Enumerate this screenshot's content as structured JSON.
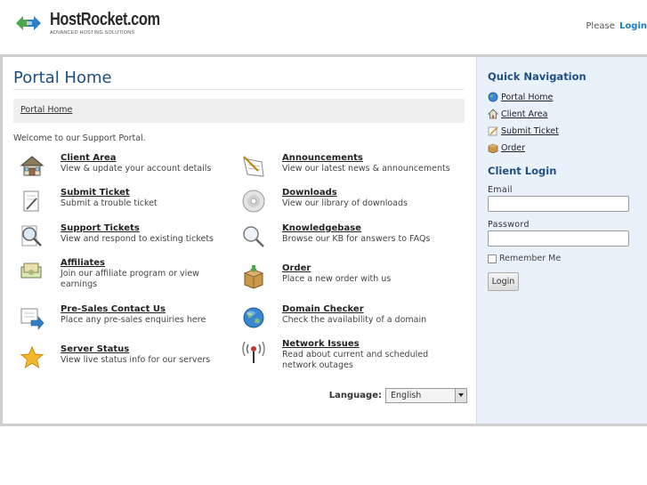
{
  "header": {
    "logo_name": "HostRocket.com",
    "logo_tagline": "ADVANCED HOSTING SOLUTIONS",
    "login_prompt": "Please",
    "login_link": "Login"
  },
  "main": {
    "title": "Portal Home",
    "breadcrumb": "Portal Home",
    "welcome": "Welcome to our Support Portal.",
    "items": [
      {
        "name": "Client Area",
        "desc": "View & update your account details",
        "icon": "house-icon"
      },
      {
        "name": "Announcements",
        "desc": "View our latest news & announcements",
        "icon": "notepad-icon"
      },
      {
        "name": "Submit Ticket",
        "desc": "Submit a trouble ticket",
        "icon": "pencil-paper-icon"
      },
      {
        "name": "Downloads",
        "desc": "View our library of downloads",
        "icon": "disc-icon"
      },
      {
        "name": "Support Tickets",
        "desc": "View and respond to existing tickets",
        "icon": "magnifier-icon"
      },
      {
        "name": "Knowledgebase",
        "desc": "Browse our KB for answers to FAQs",
        "icon": "magnifier-icon"
      },
      {
        "name": "Affiliates",
        "desc": "Join our affiliate program or view earnings",
        "icon": "money-icon"
      },
      {
        "name": "Order",
        "desc": "Place a new order with us",
        "icon": "box-icon"
      },
      {
        "name": "Pre-Sales Contact Us",
        "desc": "Place any pre-sales enquiries here",
        "icon": "document-arrow-icon"
      },
      {
        "name": "Domain Checker",
        "desc": "Check the availability of a domain",
        "icon": "globe-icon"
      },
      {
        "name": "Server Status",
        "desc": "View live status info for our servers",
        "icon": "star-icon"
      },
      {
        "name": "Network Issues",
        "desc": "Read about current and scheduled network outages",
        "icon": "antenna-icon"
      }
    ],
    "language_label": "Language:",
    "language_value": "English"
  },
  "sidebar": {
    "quick_nav_title": "Quick Navigation",
    "quick_nav": [
      {
        "label": "Portal Home",
        "icon": "globe-icon"
      },
      {
        "label": "Client Area",
        "icon": "house-icon"
      },
      {
        "label": "Submit Ticket",
        "icon": "pencil-paper-icon"
      },
      {
        "label": "Order",
        "icon": "box-icon"
      }
    ],
    "client_login_title": "Client Login",
    "email_label": "Email",
    "password_label": "Password",
    "remember_label": "Remember Me",
    "login_button": "Login"
  },
  "colors": {
    "accent": "#1f4f82",
    "link": "#1a7abf",
    "sidebar_bg": "#e9f1fb",
    "frame_border": "#cfcfcf"
  }
}
